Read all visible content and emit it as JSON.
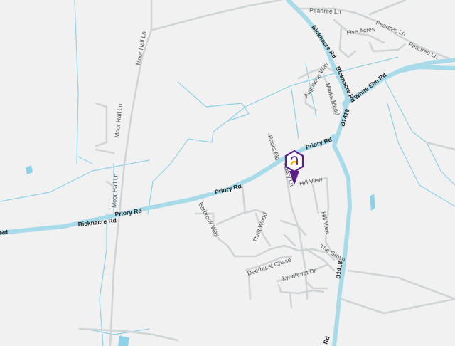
{
  "colors": {
    "background": "#f1f1f1",
    "major_road": "#a7dbe9",
    "minor_road": "#cfd4d6",
    "water": "#8fd1e6",
    "marker": "#5b1f8a",
    "marker_accent": "#f2a900"
  },
  "marker": {
    "icon": "location-pin-icon"
  },
  "labels": {
    "peartree_ln": "Peartree Ln",
    "peartree_ln_2": "Peartree Ln",
    "five_acres": "Five Acres",
    "bicknacre_rd_north": "Bicknacre Rd",
    "bicknacre_rd_west": "Bicknacre Rd",
    "moor_hall_ln_north": "Moor Hall Ln",
    "moor_hall_ln_mid": "Moor Hall Ln",
    "moor_hall_ln_south": "Moor Hall Ln",
    "augustine_way": "Augustine Way",
    "marks_mead": "Marks Mead",
    "white_elm_rd": "White Elm Rd",
    "b1418_north": "B1418",
    "b1418_south": "B1418",
    "priory_rd_east": "Priory Rd",
    "priory_rd_mid": "Priory Rd",
    "priory_rd_west": "Priory Rd",
    "priors_fld": "Priors Fld",
    "priory_ln": "Priory Ln",
    "hill_view": "Hill View",
    "hill_view_2": "Hill View",
    "barbrook_way": "Barbrook Way",
    "thrift_wood": "Thrift Wood",
    "the_grove": "The Grove",
    "deerhurst_chase": "Deerhurst Chase",
    "lyndhurst_dr": "Lyndhurst Dr",
    "rd_edge": "Rd"
  }
}
